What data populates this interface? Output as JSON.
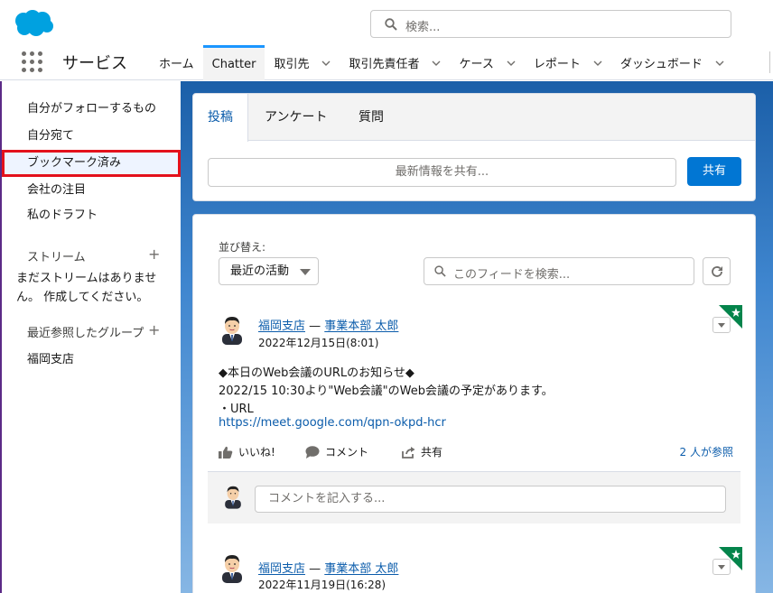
{
  "header": {
    "search_placeholder": "検索...",
    "app_name": "サービス",
    "tabs": [
      {
        "label": "ホーム",
        "has_menu": false
      },
      {
        "label": "Chatter",
        "has_menu": false,
        "active": true
      },
      {
        "label": "取引先",
        "has_menu": true
      },
      {
        "label": "取引先責任者",
        "has_menu": true
      },
      {
        "label": "ケース",
        "has_menu": true
      },
      {
        "label": "レポート",
        "has_menu": true
      },
      {
        "label": "ダッシュボード",
        "has_menu": true
      }
    ]
  },
  "sidebar": {
    "items": [
      {
        "label": "自分がフォローするもの"
      },
      {
        "label": "自分宛て"
      },
      {
        "label": "ブックマーク済み",
        "active": true
      },
      {
        "label": "会社の注目"
      },
      {
        "label": "私のドラフト"
      }
    ],
    "streams_heading": "ストリーム",
    "streams_empty": "まだストリームはありません。 作成してください。",
    "recent_groups_heading": "最近参照したグループ",
    "recent_groups": [
      "福岡支店"
    ]
  },
  "publisher": {
    "tabs": [
      "投稿",
      "アンケート",
      "質問"
    ],
    "share_placeholder": "最新情報を共有...",
    "share_button": "共有"
  },
  "feed": {
    "sort_label": "並び替え:",
    "sort_value": "最近の活動",
    "search_placeholder": "このフィードを検索...",
    "posts": [
      {
        "group": "福岡支店",
        "separator": " — ",
        "author": "事業本部 太郎",
        "date": "2022年12月15日(8:01)",
        "lines": [
          "◆本日のWeb会議のURLのお知らせ◆",
          "2022/15 10:30より\"Web会議\"のWeb会議の予定があります。",
          "・URL"
        ],
        "link": "https://meet.google.com/qpn-okpd-hcr",
        "like": "いいね!",
        "comment": "コメント",
        "share": "共有",
        "views": "2 人が参照",
        "comment_placeholder": "コメントを記入する..."
      },
      {
        "group": "福岡支店",
        "separator": " — ",
        "author": "事業本部 太郎",
        "date": "2022年11月19日(16:28)"
      }
    ]
  },
  "colors": {
    "brand_blue": "#0176d3",
    "link_blue": "#0b5cab",
    "highlight_red": "#e3111c",
    "bookmark_green": "#04844b"
  }
}
